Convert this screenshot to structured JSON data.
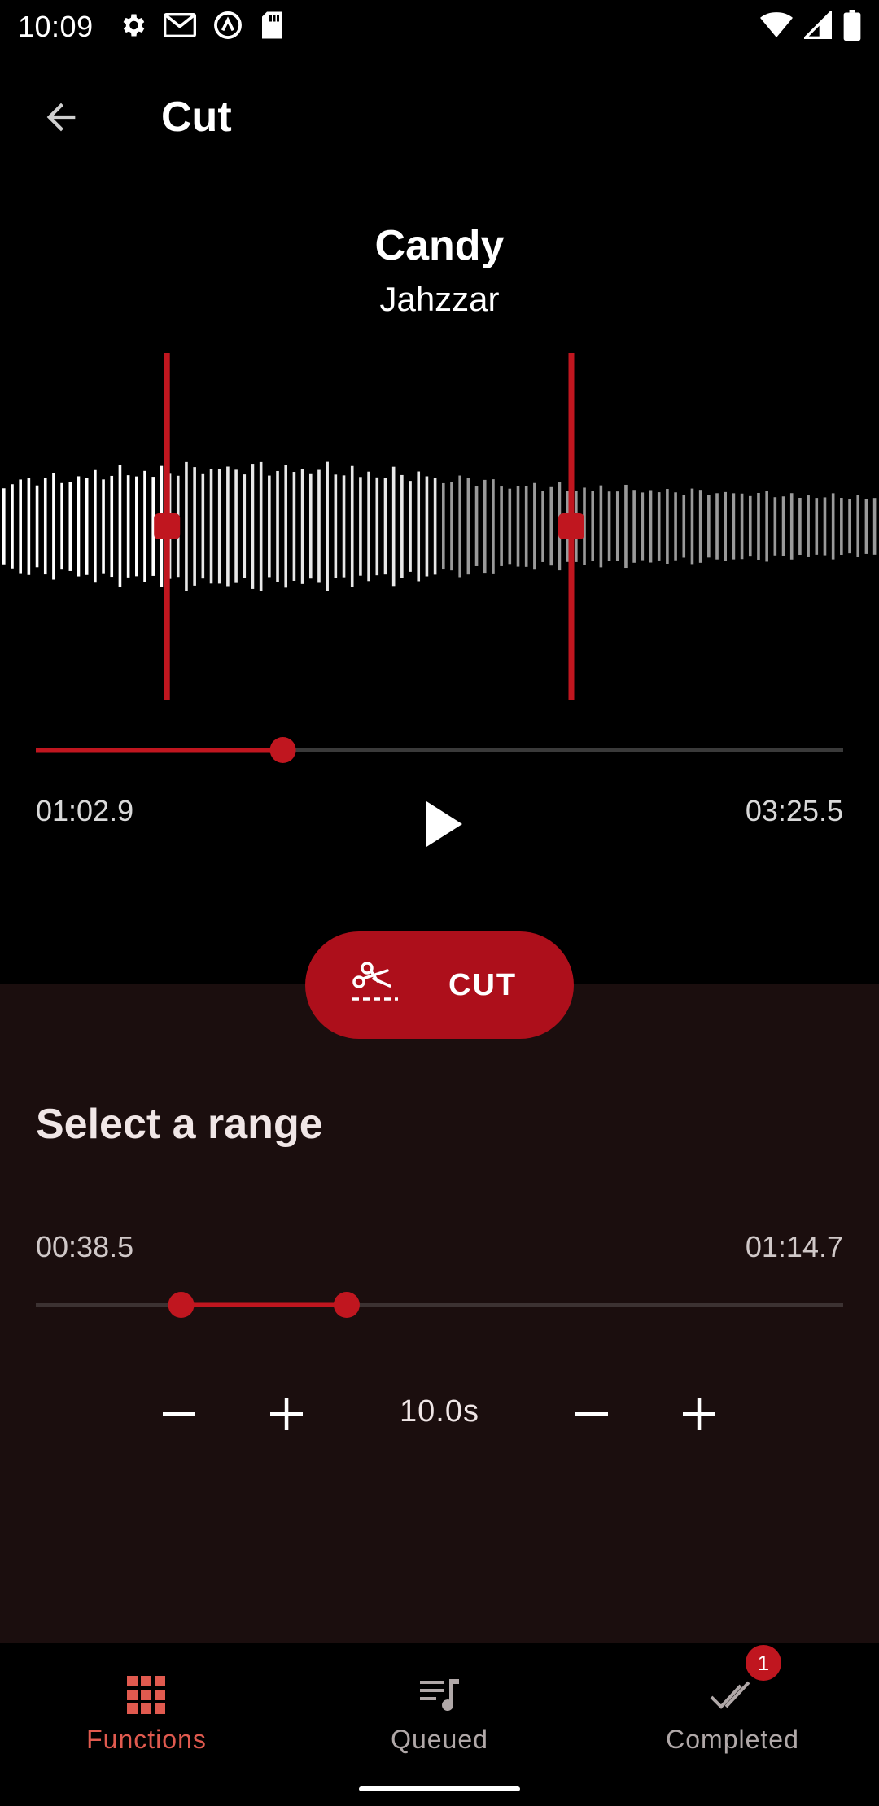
{
  "status_bar": {
    "time": "10:09",
    "left_icons": [
      "settings-icon",
      "gmail-icon",
      "vpn-icon",
      "sd-card-icon"
    ],
    "right_icons": [
      "wifi-icon",
      "signal-icon",
      "battery-icon"
    ]
  },
  "app_bar": {
    "title": "Cut",
    "back_icon": "arrow-back-icon"
  },
  "track": {
    "title": "Candy",
    "artist": "Jahzzar"
  },
  "player": {
    "position_label": "01:02.9",
    "duration_label": "03:25.5",
    "progress_fraction": 0.306,
    "play_icon": "play-icon"
  },
  "waveform": {
    "selection_start_fraction": 0.19,
    "selection_end_fraction": 0.65
  },
  "cut_button": {
    "label": "CUT",
    "icon": "cut-scissors-icon"
  },
  "range": {
    "title": "Select a range",
    "start_label": "00:38.5",
    "end_label": "01:14.7",
    "start_fraction": 0.18,
    "end_fraction": 0.385,
    "step_label": "10.0s"
  },
  "bottom_nav": {
    "items": [
      {
        "label": "Functions",
        "icon": "grid-icon",
        "active": true
      },
      {
        "label": "Queued",
        "icon": "queue-music-icon",
        "active": false
      },
      {
        "label": "Completed",
        "icon": "done-all-icon",
        "active": false,
        "badge": "1"
      }
    ]
  },
  "colors": {
    "accent": "#c0161f",
    "cut_button": "#ad0f1b",
    "sheet_background": "#1b0e0e",
    "nav_active": "#e05a4f",
    "nav_inactive": "#b0a8a8"
  }
}
